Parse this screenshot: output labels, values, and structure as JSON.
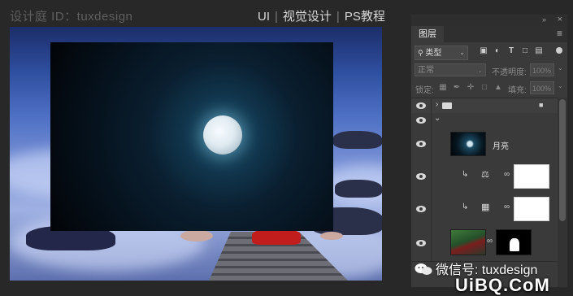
{
  "header": {
    "watermark": "设计庭 ID：tuxdesign",
    "breadcrumb": [
      "UI",
      "视觉设计",
      "PS教程"
    ]
  },
  "panel": {
    "tab_label": "图层",
    "filter": {
      "kind_label": "类型"
    },
    "blend_mode": "正常",
    "opacity_label": "不透明度:",
    "opacity_value": "100%",
    "lock_label": "锁定:",
    "fill_label": "填充:",
    "fill_value": "100%",
    "layers": [
      {
        "type": "group",
        "collapsed": true
      },
      {
        "type": "group",
        "collapsed": false
      },
      {
        "type": "pixel",
        "name": "月亮"
      },
      {
        "type": "adjustment",
        "icon": "balance-icon",
        "clipped": true
      },
      {
        "type": "adjustment",
        "icon": "levels-icon",
        "clipped": true
      },
      {
        "type": "pixel-with-mask",
        "name": ""
      }
    ]
  },
  "watermarks": {
    "wechat": "微信号: tuxdesign",
    "site": "UiBQ.CoM"
  },
  "colors": {
    "panel_bg": "#3a3a3a",
    "canvas_sky": "#2f4fa0",
    "moon_glow": "#1e5a76"
  }
}
